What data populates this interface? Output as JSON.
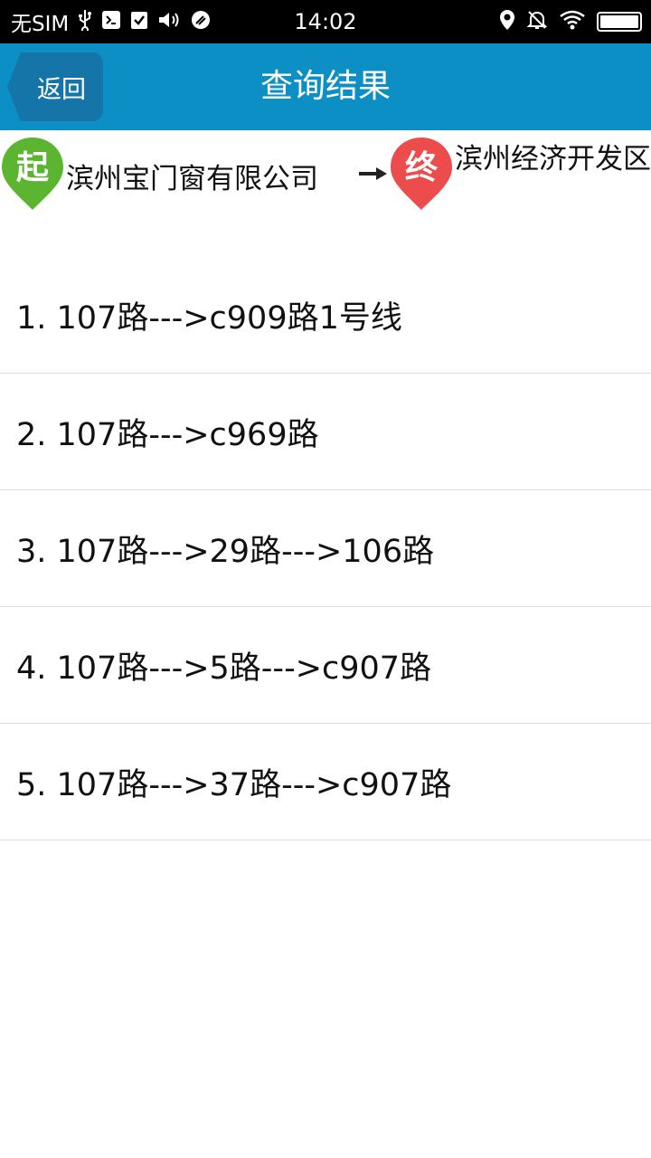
{
  "status_bar": {
    "carrier": "无SIM",
    "time": "14:02",
    "icons_left": [
      "usb-icon",
      "debug-icon",
      "checkbox-icon",
      "volume-icon",
      "clean-icon"
    ],
    "icons_right": [
      "location-icon",
      "alarm-off-icon",
      "wifi-icon",
      "battery-icon"
    ]
  },
  "navbar": {
    "back_label": "返回",
    "title": "查询结果",
    "color": "#0b8fc5"
  },
  "route": {
    "start_badge": "起",
    "start_name": "滨州宝门窗有限公司",
    "end_badge": "终",
    "end_name": "滨州经济开发区",
    "start_color": "#5cb531",
    "end_color": "#ec4c4c"
  },
  "results": [
    {
      "text": "1. 107路--->c909路1号线"
    },
    {
      "text": "2. 107路--->c969路"
    },
    {
      "text": "3. 107路--->29路--->106路"
    },
    {
      "text": "4. 107路--->5路--->c907路"
    },
    {
      "text": "5. 107路--->37路--->c907路"
    }
  ]
}
